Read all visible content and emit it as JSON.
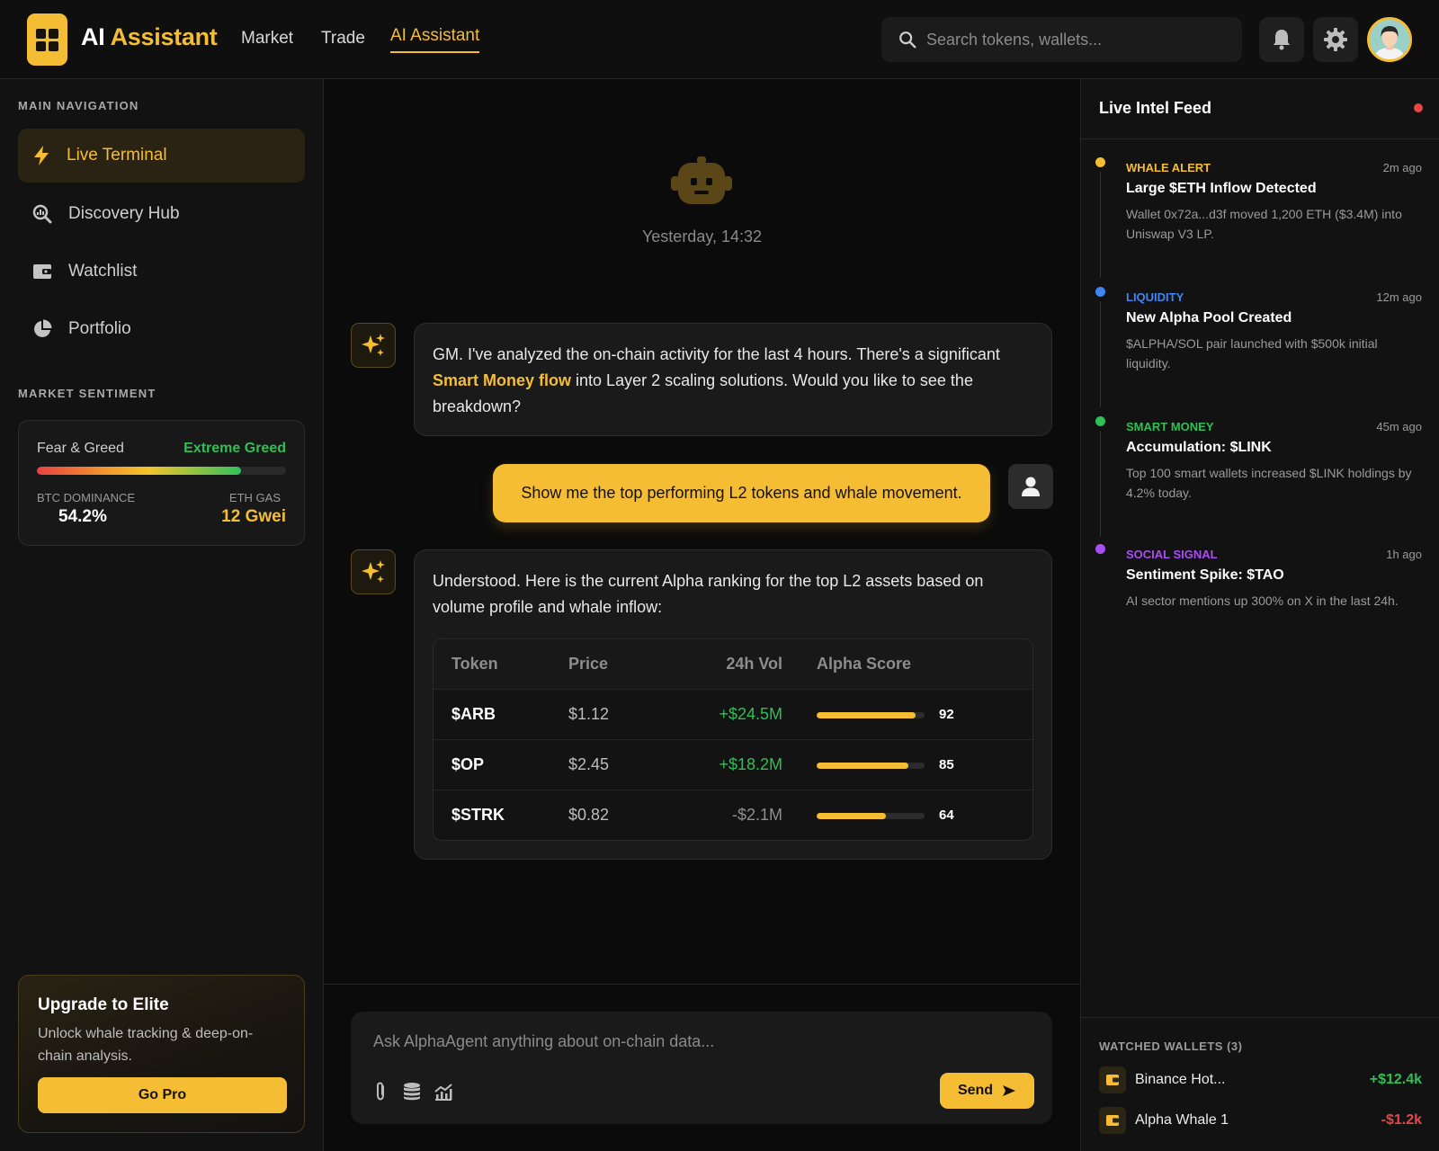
{
  "brand": {
    "prefix": "AI",
    "accent": "Assistant"
  },
  "nav": [
    {
      "label": "Market"
    },
    {
      "label": "Trade"
    },
    {
      "label": "AI Assistant",
      "active": true
    }
  ],
  "search": {
    "placeholder": "Search tokens, wallets..."
  },
  "header_icons": [
    "bell-icon",
    "gear-icon",
    "avatar"
  ],
  "sidebar": {
    "main_nav_title": "MAIN NAVIGATION",
    "items": [
      {
        "label": "Live Terminal",
        "icon": "bolt-icon",
        "active": true
      },
      {
        "label": "Discovery Hub",
        "icon": "discovery-search-icon"
      },
      {
        "label": "Watchlist",
        "icon": "wallet-icon"
      },
      {
        "label": "Portfolio",
        "icon": "pie-chart-icon"
      }
    ],
    "sentiment_title": "MARKET SENTIMENT",
    "sentiment": {
      "label": "Fear & Greed",
      "value": "Extreme Greed",
      "gauge_fraction": 0.82,
      "btc_label": "BTC DOMINANCE",
      "btc_value": "54.2%",
      "gas_label": "ETH GAS",
      "gas_value": "12 Gwei"
    },
    "upgrade": {
      "title": "Upgrade to Elite",
      "desc": "Unlock whale tracking & deep-on-chain analysis.",
      "button": "Go Pro"
    }
  },
  "chat": {
    "timestamp": "Yesterday, 14:32",
    "msg1": {
      "part1": "GM. I've analyzed the on-chain activity for the last 4 hours. There's a significant ",
      "highlight": "Smart Money flow",
      "part2": " into Layer 2 scaling solutions. Would you like to see the breakdown?"
    },
    "user_msg": "Show me the top performing L2 tokens and whale movement.",
    "msg2": "Understood. Here is the current Alpha ranking for the top L2 assets based on volume profile and whale inflow:",
    "table": {
      "headers": {
        "token": "Token",
        "price": "Price",
        "vol": "24h Vol",
        "score": "Alpha Score"
      },
      "rows": [
        {
          "token": "$ARB",
          "price": "$1.12",
          "vol": "+$24.5M",
          "score": "92",
          "score_fraction": 0.92,
          "vol_color": "#2fbf55"
        },
        {
          "token": "$OP",
          "price": "$2.45",
          "vol": "+$18.2M",
          "score": "85",
          "score_fraction": 0.85,
          "vol_color": "#2fbf55"
        },
        {
          "token": "$STRK",
          "price": "$0.82",
          "vol": "-$2.1M",
          "score": "64",
          "score_fraction": 0.64,
          "vol_color": "#8f8f8f"
        }
      ]
    },
    "composer": {
      "placeholder": "Ask AlphaAgent anything about on-chain data...",
      "send": "Send"
    }
  },
  "intel": {
    "title": "Live Intel Feed",
    "items": [
      {
        "category": "WHALE ALERT",
        "color": "#f4bd34",
        "time": "2m ago",
        "title": "Large $ETH Inflow Detected",
        "desc": "Wallet 0x72a...d3f moved 1,200 ETH ($3.4M) into Uniswap V3 LP."
      },
      {
        "category": "LIQUIDITY",
        "color": "#3f86f2",
        "time": "12m ago",
        "title": "New Alpha Pool Created",
        "desc": "$ALPHA/SOL pair launched with $500k initial liquidity."
      },
      {
        "category": "SMART MONEY",
        "color": "#2fbf55",
        "time": "45m ago",
        "title": "Accumulation: $LINK",
        "desc": "Top 100 smart wallets increased $LINK holdings by 4.2% today."
      },
      {
        "category": "SOCIAL SIGNAL",
        "color": "#a84ef2",
        "time": "1h ago",
        "title": "Sentiment Spike: $TAO",
        "desc": "AI sector mentions up 300% on X in the last 24h."
      }
    ],
    "wallets_title": "WATCHED WALLETS (3)",
    "wallets": [
      {
        "name": "Binance Hot...",
        "value": "+$12.4k",
        "color": "#2fbf55"
      },
      {
        "name": "Alpha Whale 1",
        "value": "-$1.2k",
        "color": "#e84646"
      }
    ]
  }
}
